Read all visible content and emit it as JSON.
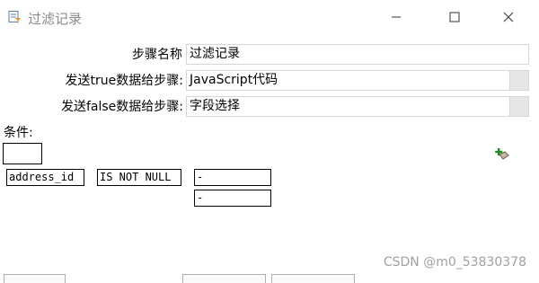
{
  "window": {
    "title": "过滤记录"
  },
  "form": {
    "step_name_label": "步骤名称",
    "step_name_value": "过滤记录",
    "send_true_label": "发送true数据给步骤:",
    "send_true_value": "JavaScript代码",
    "send_false_label": "发送false数据给步骤:",
    "send_false_value": "字段选择"
  },
  "condition": {
    "label": "条件:",
    "left_field": "address_id",
    "function": "IS NOT NULL",
    "right_field": "-",
    "right_value": "-"
  },
  "watermark": "CSDN @m0_53830378",
  "icons": {
    "app": "filter-rows-icon",
    "minimize": "minimize-icon",
    "maximize": "maximize-icon",
    "close": "close-icon",
    "add_condition": "add-condition-icon"
  }
}
